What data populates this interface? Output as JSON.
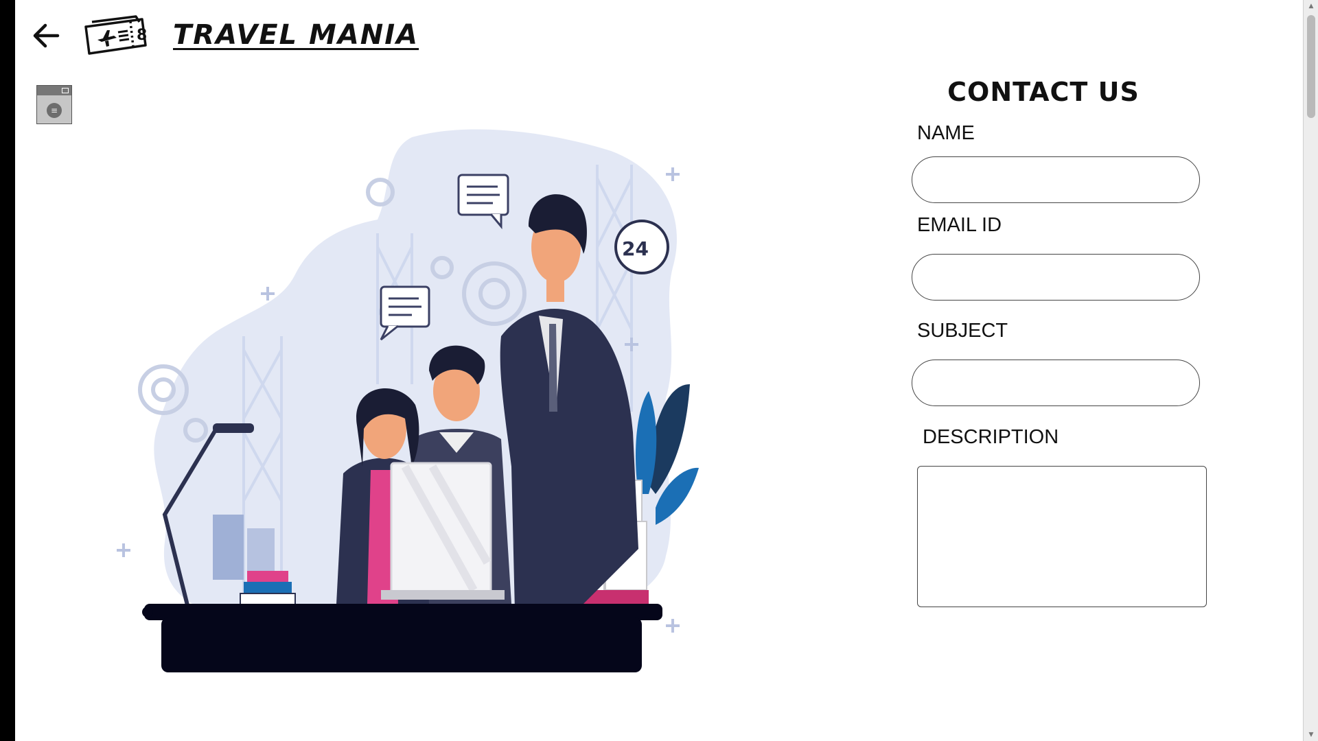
{
  "header": {
    "brand": "TRAVEL MANIA",
    "back_icon": "arrow-left-icon",
    "logo_icon": "airplane-ticket-icon"
  },
  "widget": {
    "icon": "window-menu-icon"
  },
  "illustration": {
    "subject": "customer-support-team-illustration",
    "badge": "24"
  },
  "contact": {
    "title": "CONTACT US",
    "fields": [
      {
        "label": "NAME",
        "value": ""
      },
      {
        "label": "EMAIL ID",
        "value": ""
      },
      {
        "label": "SUBJECT",
        "value": ""
      },
      {
        "label": "DESCRIPTION",
        "value": ""
      }
    ]
  },
  "colors": {
    "background": "#ffffff",
    "text": "#111111",
    "illustration_bg": "#e3e8f5",
    "navy": "#2c3150",
    "pink": "#e0428a",
    "blue_leaf": "#1b6fb5"
  }
}
